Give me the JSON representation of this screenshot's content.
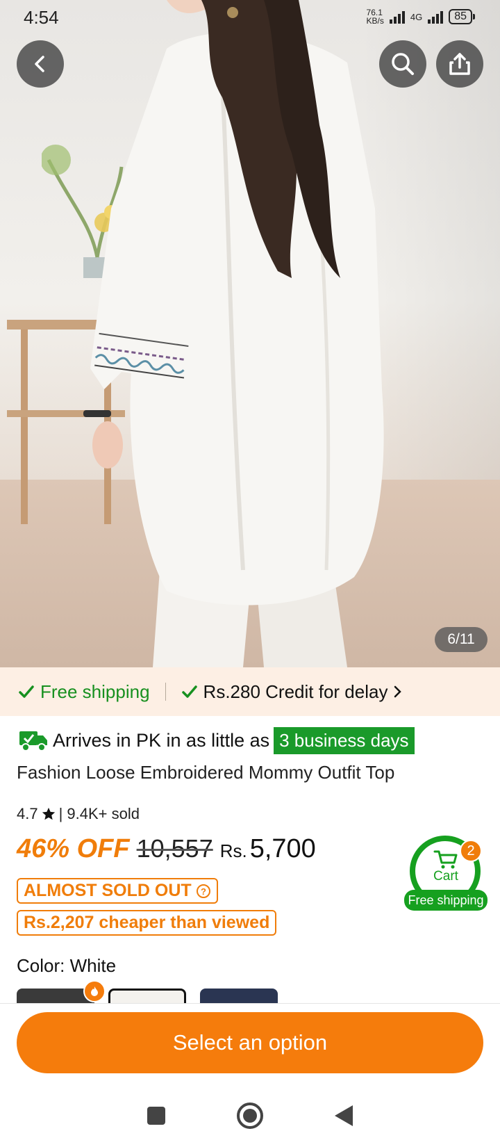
{
  "status_bar": {
    "time": "4:54",
    "net_speed": "76.1\nKB/s",
    "network": "4G",
    "battery": "85"
  },
  "gallery": {
    "counter": "6/11"
  },
  "shipping_banner": {
    "free_shipping": "Free shipping",
    "credit": "Rs.280 Credit for delay"
  },
  "arrival": {
    "prefix": "Arrives in PK in as little as",
    "days": "3 business days"
  },
  "product": {
    "title": "Fashion Loose Embroidered Mommy Outfit Top",
    "rating": "4.7",
    "sold": "| 9.4K+ sold",
    "discount": "46% OFF",
    "original_price": "10,557",
    "currency": "Rs.",
    "price": "5,700",
    "stock_badge": "ALMOST SOLD OUT",
    "savings": "Rs.2,207 cheaper than viewed",
    "color_label": "Color: White"
  },
  "cart": {
    "label": "Cart",
    "shipping": "Free shipping",
    "count": "2"
  },
  "cta": {
    "label": "Select an option"
  },
  "colors": {
    "accent_orange": "#f57c0c",
    "green": "#16a01f",
    "banner_bg": "#fdefe4"
  }
}
